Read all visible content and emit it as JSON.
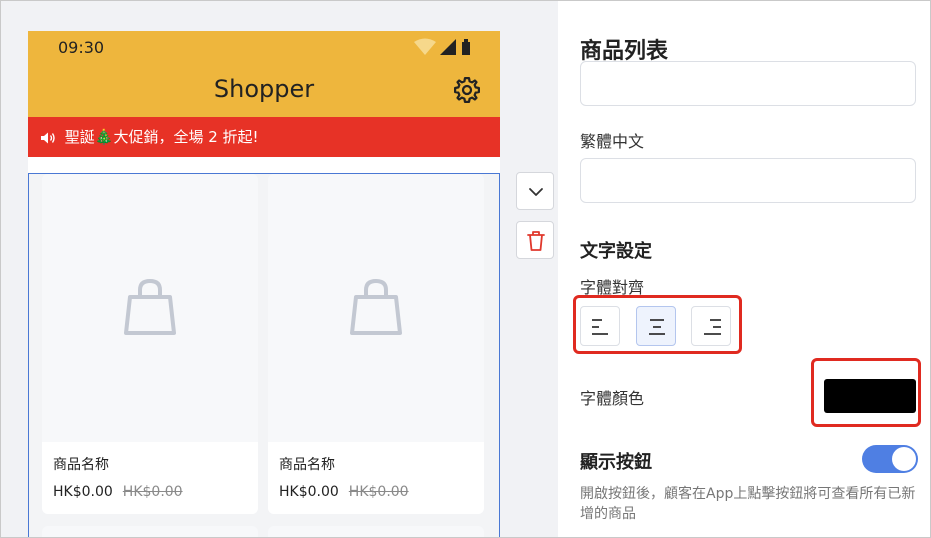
{
  "status_bar": {
    "time": "09:30"
  },
  "app": {
    "title": "Shopper",
    "settings_icon": "gear-icon"
  },
  "banner": {
    "text": "聖誕🎄大促銷，全場 2 折起!",
    "icon": "speaker-icon"
  },
  "products": [
    {
      "name": "商品名称",
      "price": "HK$0.00",
      "original_price": "HK$0.00",
      "image_icon": "shopping-bag-icon"
    },
    {
      "name": "商品名称",
      "price": "HK$0.00",
      "original_price": "HK$0.00",
      "image_icon": "shopping-bag-icon"
    }
  ],
  "side_actions": [
    {
      "name": "collapse",
      "icon": "chevron-down-icon"
    },
    {
      "name": "delete",
      "icon": "trash-icon"
    }
  ],
  "panel": {
    "title": "商品列表",
    "traditional_chinese_label": "繁體中文",
    "traditional_chinese_value": "",
    "text_settings_heading": "文字設定",
    "alignment_label": "字體對齊",
    "alignment_options": [
      "align-left",
      "align-center",
      "align-right"
    ],
    "alignment_selected": "align-center",
    "font_color_label": "字體顏色",
    "font_color_value": "#000000",
    "show_button_label": "顯示按鈕",
    "show_button_enabled": true,
    "show_button_description": "開啟按鈕後，顧客在App上點擊按鈕將可查看所有已新增的商品"
  },
  "colors": {
    "header_yellow": "#eeb63d",
    "banner_red": "#e73226",
    "selection_blue": "#4a78d4",
    "highlight_red": "#e02a20",
    "toggle_blue": "#4f7fe3"
  }
}
